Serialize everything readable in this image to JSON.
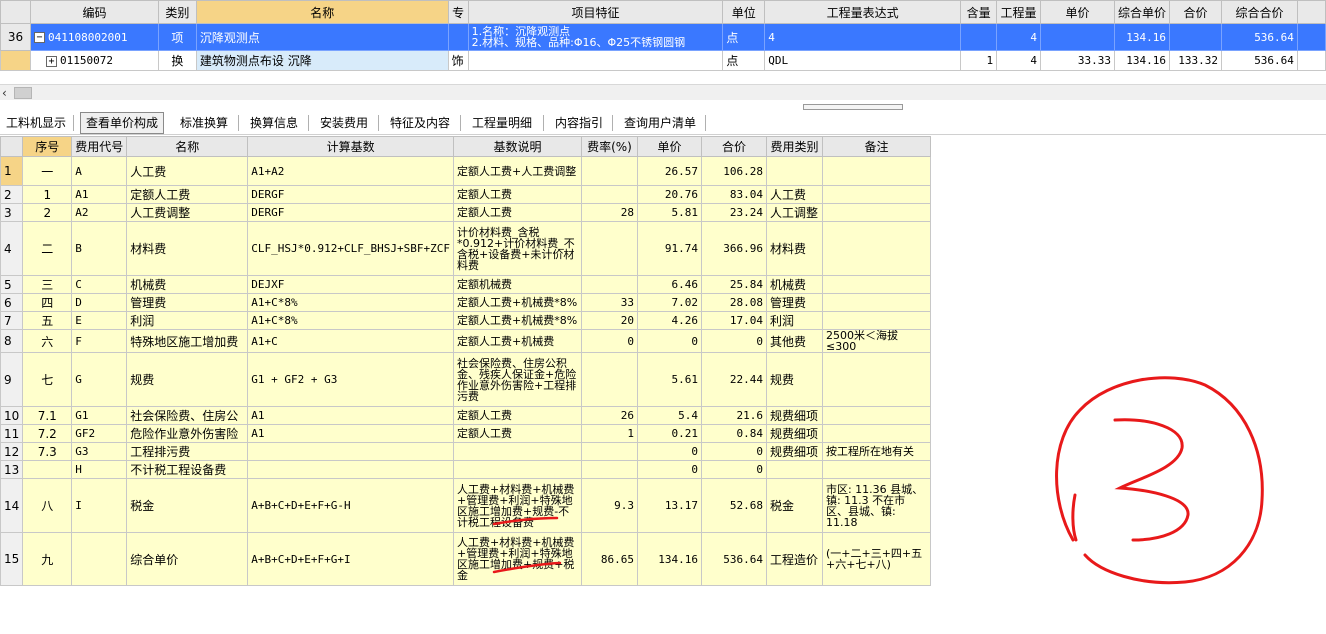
{
  "top_grid": {
    "headers": [
      "编码",
      "类别",
      "名称",
      "专",
      "项目特征",
      "单位",
      "工程量表达式",
      "含量",
      "工程量",
      "单价",
      "综合单价",
      "合价",
      "综合合价"
    ],
    "rows": [
      {
        "rn": "36",
        "code": "041108002001",
        "type": "项",
        "name": "沉降观测点",
        "spec": "",
        "feature1": "1.名称：沉降观测点",
        "feature2": "2.材料、规格、品种:Φ16、Φ25不锈钢圆钢",
        "unit": "点",
        "expr": "4",
        "content": "",
        "qty": "4",
        "price": "",
        "comp_price": "134.16",
        "total": "",
        "comp_total": "536.64",
        "tree": "−"
      },
      {
        "rn": "",
        "code": "01150072",
        "type": "换",
        "name": "建筑物测点布设 沉降",
        "spec": "饰",
        "feature1": "",
        "feature2": "",
        "unit": "点",
        "expr": "QDL",
        "content": "1",
        "qty": "4",
        "price": "33.33",
        "comp_price": "134.16",
        "total": "133.32",
        "comp_total": "536.64",
        "tree": "+"
      }
    ]
  },
  "tabs": [
    "工料机显示",
    "查看单价构成",
    "标准换算",
    "换算信息",
    "安装费用",
    "特征及内容",
    "工程量明细",
    "内容指引",
    "查询用户清单"
  ],
  "active_tab": 1,
  "cost_table": {
    "headers": [
      "序号",
      "费用代号",
      "名称",
      "计算基数",
      "基数说明",
      "费率(%)",
      "单价",
      "合价",
      "费用类别",
      "备注"
    ],
    "rows": [
      {
        "rn": "1",
        "seq": "一",
        "code": "A",
        "name": "人工费",
        "base": "A1+A2",
        "desc": "定额人工费+人工费调整",
        "rate": "",
        "price": "26.57",
        "total": "106.28",
        "cat": "",
        "note": ""
      },
      {
        "rn": "2",
        "seq": "1",
        "code": "A1",
        "name": "定额人工费",
        "base": "DERGF",
        "desc": "定额人工费",
        "rate": "",
        "price": "20.76",
        "total": "83.04",
        "cat": "人工费",
        "note": ""
      },
      {
        "rn": "3",
        "seq": "2",
        "code": "A2",
        "name": "人工费调整",
        "base": "DERGF",
        "desc": "定额人工费",
        "rate": "28",
        "price": "5.81",
        "total": "23.24",
        "cat": "人工调整",
        "note": ""
      },
      {
        "rn": "4",
        "seq": "二",
        "code": "B",
        "name": "材料费",
        "base": "CLF_HSJ*0.912+CLF_BHSJ+SBF+ZCF",
        "desc": "计价材料费_含税*0.912+计价材料费_不含税+设备费+未计价材料费",
        "rate": "",
        "price": "91.74",
        "total": "366.96",
        "cat": "材料费",
        "note": ""
      },
      {
        "rn": "5",
        "seq": "三",
        "code": "C",
        "name": "机械费",
        "base": "DEJXF",
        "desc": "定额机械费",
        "rate": "",
        "price": "6.46",
        "total": "25.84",
        "cat": "机械费",
        "note": ""
      },
      {
        "rn": "6",
        "seq": "四",
        "code": "D",
        "name": "管理费",
        "base": "A1+C*8%",
        "desc": "定额人工费+机械费*8%",
        "rate": "33",
        "price": "7.02",
        "total": "28.08",
        "cat": "管理费",
        "note": ""
      },
      {
        "rn": "7",
        "seq": "五",
        "code": "E",
        "name": "利润",
        "base": "A1+C*8%",
        "desc": "定额人工费+机械费*8%",
        "rate": "20",
        "price": "4.26",
        "total": "17.04",
        "cat": "利润",
        "note": ""
      },
      {
        "rn": "8",
        "seq": "六",
        "code": "F",
        "name": "特殊地区施工增加费",
        "base": "A1+C",
        "desc": "定额人工费+机械费",
        "rate": "0",
        "price": "0",
        "total": "0",
        "cat": "其他费",
        "note": "2500米＜海拔≤300"
      },
      {
        "rn": "9",
        "seq": "七",
        "code": "G",
        "name": "规费",
        "base": "G1 + GF2 + G3",
        "desc": "社会保险费、住房公积金、残疾人保证金+危险作业意外伤害险+工程排污费",
        "rate": "",
        "price": "5.61",
        "total": "22.44",
        "cat": "规费",
        "note": ""
      },
      {
        "rn": "10",
        "seq": "7.1",
        "code": "G1",
        "name": "社会保险费、住房公",
        "base": "A1",
        "desc": "定额人工费",
        "rate": "26",
        "price": "5.4",
        "total": "21.6",
        "cat": "规费细项",
        "note": ""
      },
      {
        "rn": "11",
        "seq": "7.2",
        "code": "GF2",
        "name": "危险作业意外伤害险",
        "base": "A1",
        "desc": "定额人工费",
        "rate": "1",
        "price": "0.21",
        "total": "0.84",
        "cat": "规费细项",
        "note": ""
      },
      {
        "rn": "12",
        "seq": "7.3",
        "code": "G3",
        "name": "工程排污费",
        "base": "",
        "desc": "",
        "rate": "",
        "price": "0",
        "total": "0",
        "cat": "规费细项",
        "note": "按工程所在地有关"
      },
      {
        "rn": "13",
        "seq": "",
        "code": "H",
        "name": "不计税工程设备费",
        "base": "",
        "desc": "",
        "rate": "",
        "price": "0",
        "total": "0",
        "cat": "",
        "note": ""
      },
      {
        "rn": "14",
        "seq": "八",
        "code": "I",
        "name": "税金",
        "base": "A+B+C+D+E+F+G-H",
        "desc": "人工费+材料费+机械费+管理费+利润+特殊地区施工增加费+规费-不计税工程设备费",
        "rate": "9.3",
        "price": "13.17",
        "total": "52.68",
        "cat": "税金",
        "note": "市区: 11.36 县城、镇: 11.3 不在市区、县城、镇: 11.18"
      },
      {
        "rn": "15",
        "seq": "九",
        "code": "",
        "name": "综合单价",
        "base": "A+B+C+D+E+F+G+I",
        "desc": "人工费+材料费+机械费+管理费+利润+特殊地区施工增加费+规费+税金",
        "rate": "86.65",
        "price": "134.16",
        "total": "536.64",
        "cat": "工程造价",
        "note": "(一+二+三+四+五+六+七+八)"
      }
    ]
  },
  "annotation": {
    "color": "#e8191a",
    "mark_text": "3"
  }
}
